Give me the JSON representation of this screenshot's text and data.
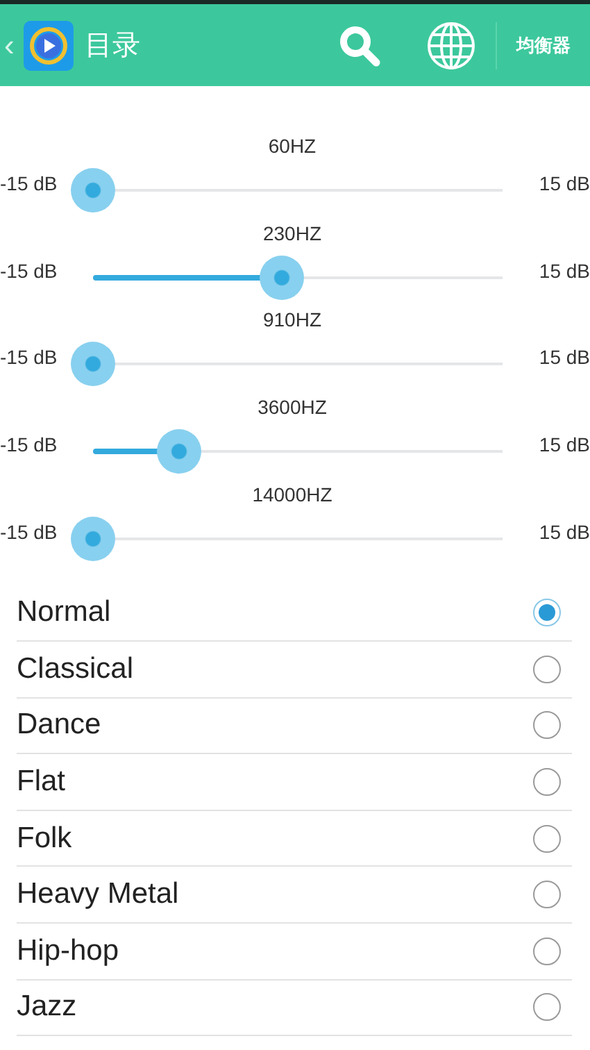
{
  "header": {
    "back": "‹",
    "title": "目录",
    "action": "均衡器"
  },
  "bands": [
    {
      "frequency": "60HZ",
      "min": "-15 dB",
      "max": "15 dB",
      "level": 0
    },
    {
      "frequency": "230HZ",
      "min": "-15 dB",
      "max": "15 dB",
      "level": 0.46
    },
    {
      "frequency": "910HZ",
      "min": "-15 dB",
      "max": "15 dB",
      "level": 0
    },
    {
      "frequency": "3600HZ",
      "min": "-15 dB",
      "max": "15 dB",
      "level": 0.21
    },
    {
      "frequency": "14000HZ",
      "min": "-15 dB",
      "max": "15 dB",
      "level": 0
    }
  ],
  "presets": [
    {
      "label": "Normal",
      "selected": true
    },
    {
      "label": "Classical",
      "selected": false
    },
    {
      "label": "Dance",
      "selected": false
    },
    {
      "label": "Flat",
      "selected": false
    },
    {
      "label": "Folk",
      "selected": false
    },
    {
      "label": "Heavy Metal",
      "selected": false
    },
    {
      "label": "Hip-hop",
      "selected": false
    },
    {
      "label": "Jazz",
      "selected": false
    }
  ]
}
